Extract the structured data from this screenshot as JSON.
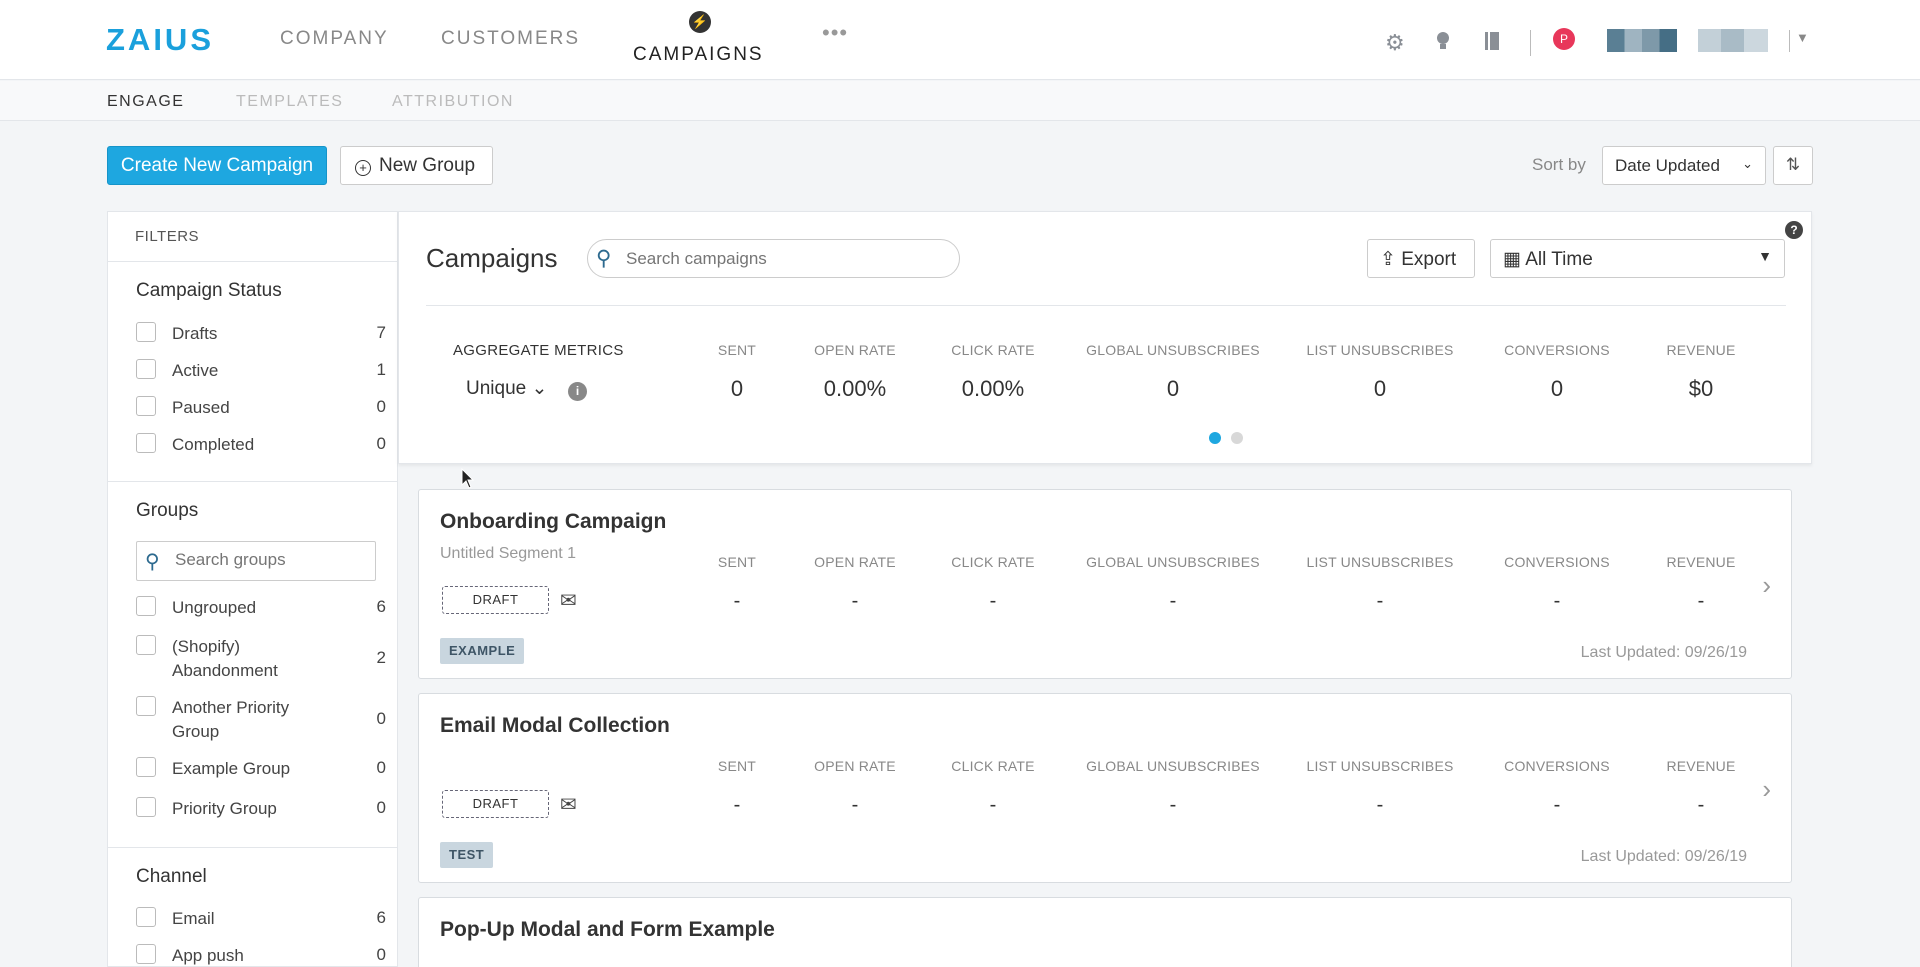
{
  "topnav": {
    "logo": "ZAIUS",
    "items": [
      "COMPANY",
      "CUSTOMERS",
      "CAMPAIGNS"
    ],
    "more": "•••",
    "avatar_initial": "P",
    "icons": [
      "gear-icon",
      "lightbulb-icon",
      "book-icon"
    ]
  },
  "subnav": {
    "items": [
      "ENGAGE",
      "TEMPLATES",
      "ATTRIBUTION"
    ]
  },
  "actions": {
    "create_label": "Create New Campaign",
    "new_group_label": "New Group",
    "sort_by_label": "Sort by",
    "sort_value": "Date Updated"
  },
  "filters": {
    "header": "FILTERS",
    "status": {
      "title": "Campaign Status",
      "items": [
        {
          "label": "Drafts",
          "count": "7"
        },
        {
          "label": "Active",
          "count": "1"
        },
        {
          "label": "Paused",
          "count": "0"
        },
        {
          "label": "Completed",
          "count": "0"
        }
      ]
    },
    "groups": {
      "title": "Groups",
      "search_placeholder": "Search groups",
      "items": [
        {
          "label": "Ungrouped",
          "count": "6"
        },
        {
          "label": "(Shopify) Abandonment",
          "count": "2"
        },
        {
          "label": "Another Priority Group",
          "count": "0"
        },
        {
          "label": "Example Group",
          "count": "0"
        },
        {
          "label": "Priority Group",
          "count": "0"
        }
      ]
    },
    "channel": {
      "title": "Channel",
      "items": [
        {
          "label": "Email",
          "count": "6"
        },
        {
          "label": "App push",
          "count": "0"
        }
      ]
    }
  },
  "campaigns": {
    "title": "Campaigns",
    "search_placeholder": "Search campaigns",
    "export_label": "Export",
    "time_value": "All Time",
    "help": "?",
    "aggregate": {
      "label": "AGGREGATE METRICS",
      "mode": "Unique",
      "headers": [
        "SENT",
        "OPEN RATE",
        "CLICK RATE",
        "GLOBAL UNSUBSCRIBES",
        "LIST UNSUBSCRIBES",
        "CONVERSIONS",
        "REVENUE"
      ],
      "values": [
        "0",
        "0.00%",
        "0.00%",
        "0",
        "0",
        "0",
        "$0"
      ]
    },
    "list": [
      {
        "title": "Onboarding Campaign",
        "segment": "Untitled Segment 1",
        "status": "DRAFT",
        "tag": "EXAMPLE",
        "headers": [
          "SENT",
          "OPEN RATE",
          "CLICK RATE",
          "GLOBAL UNSUBSCRIBES",
          "LIST UNSUBSCRIBES",
          "CONVERSIONS",
          "REVENUE"
        ],
        "values": [
          "-",
          "-",
          "-",
          "-",
          "-",
          "-",
          "-"
        ],
        "last_updated": "Last Updated: 09/26/19"
      },
      {
        "title": "Email Modal Collection",
        "segment": "",
        "status": "DRAFT",
        "tag": "TEST",
        "headers": [
          "SENT",
          "OPEN RATE",
          "CLICK RATE",
          "GLOBAL UNSUBSCRIBES",
          "LIST UNSUBSCRIBES",
          "CONVERSIONS",
          "REVENUE"
        ],
        "values": [
          "-",
          "-",
          "-",
          "-",
          "-",
          "-",
          "-"
        ],
        "last_updated": "Last Updated: 09/26/19"
      },
      {
        "title": "Pop-Up Modal and Form Example"
      }
    ]
  },
  "colors": {
    "accent": "#1ea7e0",
    "logo": "#1aa0dc",
    "avatar": "#e8375a",
    "tag_bg": "#c9d6df"
  }
}
